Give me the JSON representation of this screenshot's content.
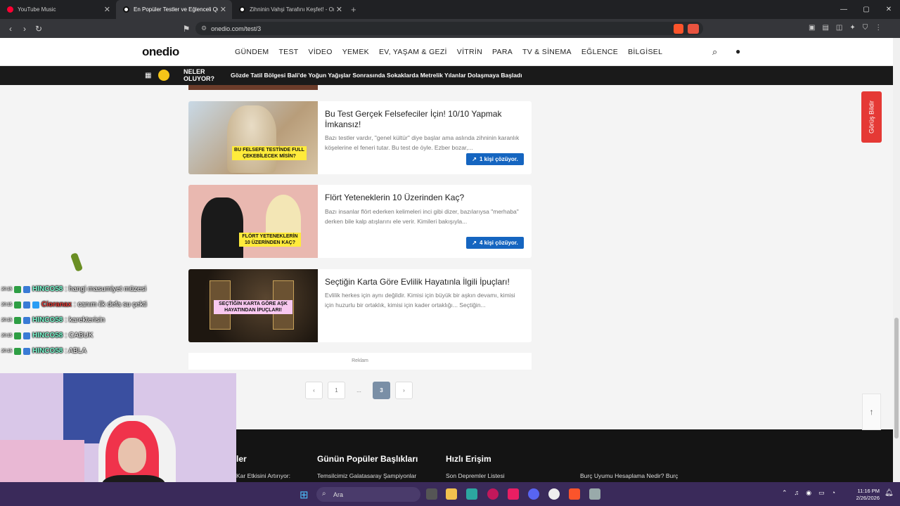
{
  "browser": {
    "tabs": [
      {
        "title": "YouTube Music",
        "color": "#ff0033",
        "active": false
      },
      {
        "title": "En Popüler Testler ve Eğlenceli Quizler",
        "color": "#111111",
        "active": true
      },
      {
        "title": "Zihninin Vahşi Tarafını Keşfet! - Onedio",
        "color": "#111111",
        "active": false
      }
    ],
    "url": "onedio.com/test/3"
  },
  "site": {
    "logo": "onedio",
    "menu": [
      "GÜNDEM",
      "TEST",
      "VİDEO",
      "YEMEK",
      "EV, YAŞAM & GEZİ",
      "VİTRİN",
      "PARA",
      "TV & SİNEMA",
      "EĞLENCE",
      "BİLGİSEL"
    ],
    "news_badge": "NELER OLUYOR?",
    "news_text": "Gözde Tatil Bölgesi Bali'de Yoğun Yağışlar Sonrasında Sokaklarda Metrelik Yılanlar Dolaşmaya Başladı",
    "feedback": "Görüş Bildir"
  },
  "cards": [
    {
      "title": "Bu Test Gerçek Felsefeciler İçin! 10/10 Yapmak İmkansız!",
      "desc": "Bazı testler vardır, \"genel kültür\" diye başlar ama aslında zihninin karanlık köşelerine el feneri tutar. Bu test de öyle. Ezber bozar,...",
      "caption": "BU FELSEFE TESTİNDE FULL ÇEKEBİLECEK MİSİN?",
      "badge": "1 kişi çözüyor."
    },
    {
      "title": "Flört Yeteneklerin 10 Üzerinden Kaç?",
      "desc": "Bazı insanlar flört ederken kelimeleri inci gibi dizer, bazılarıysa \"merhaba\" derken bile kalp atışlarını ele verir. Kimileri bakışıyla...",
      "caption": "FLÖRT YETENEKLERİN 10 ÜZERİNDEN KAÇ?",
      "badge": "4 kişi çözüyor."
    },
    {
      "title": "Seçtiğin Karta Göre Evlilik Hayatınla İlgili İpuçları!",
      "desc": "Evlilik herkes için aynı değildir. Kimisi için büyük bir aşkın devamı, kimisi için huzurlu bir ortaklık, kimisi için kader ortaklığı... Seçtiğin...",
      "caption": "SEÇTİĞİN KARTA GÖRE AŞK HAYATINDAN İPUÇLARI!",
      "badge": ""
    }
  ],
  "ad_label": "Reklam",
  "pagination": [
    "‹",
    "1",
    "...",
    "3",
    "›"
  ],
  "footer": {
    "headings": [
      "ler",
      "Günün Popüler Başlıkları",
      "Hızlı Erişim"
    ],
    "items": [
      "Kar Etkisini Artırıyor:",
      "Temsilcimiz Galatasaray Şampiyonlar",
      "Son Depremler Listesi",
      "Burç Uyumu Hesaplama Nedir? Burç"
    ]
  },
  "chat": [
    {
      "time": "20:15",
      "user": "HINCO58",
      "color": "#7fffd4",
      "msg": ": hangi masumiyet müzesi"
    },
    {
      "time": "20:15",
      "user": "Cioranax",
      "color": "#e53935",
      "msg": ": canım ilk defa su çekti"
    },
    {
      "time": "20:15",
      "user": "HINCO58",
      "color": "#7fffd4",
      "msg": ": karekterisin"
    },
    {
      "time": "20:15",
      "user": "HINCO58",
      "color": "#7fffd4",
      "msg": ": CABUK"
    },
    {
      "time": "20:15",
      "user": "HINCO58",
      "color": "#7fffd4",
      "msg": ": ABLA"
    }
  ],
  "taskbar": {
    "search": "Ara",
    "time": "11:16 PM",
    "date": "2/26/2026"
  }
}
